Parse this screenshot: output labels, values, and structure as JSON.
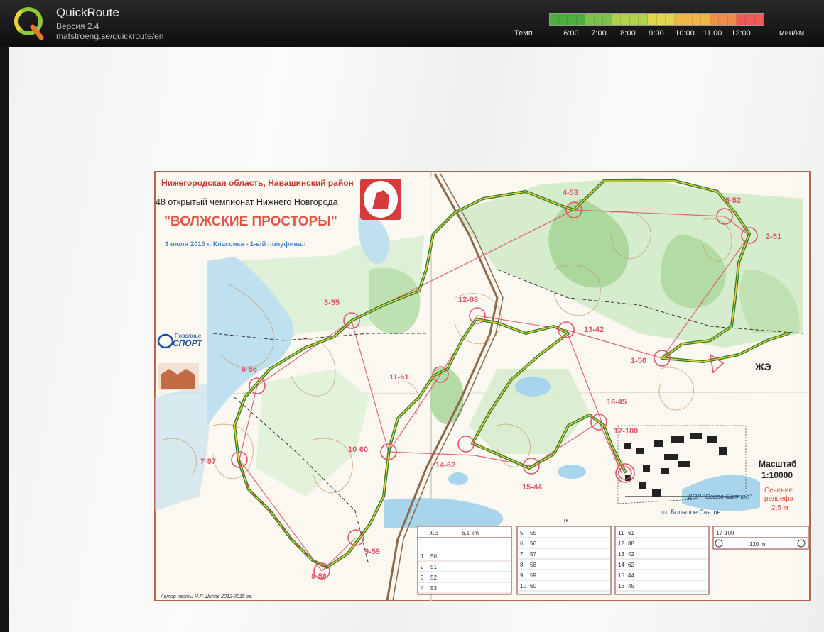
{
  "app": {
    "title": "QuickRoute",
    "version": "Версия 2.4",
    "url": "matstroeng.se/quickroute/en"
  },
  "pace_scale": {
    "label": "Темп",
    "unit": "мин/км",
    "ticks": [
      "6:00",
      "7:00",
      "8:00",
      "9:00",
      "10:00",
      "11:00",
      "12:00"
    ],
    "colors": [
      "#4cae3c",
      "#7cc24a",
      "#b3d24c",
      "#e2d64a",
      "#f0b744",
      "#ef8c4a",
      "#ef5a5a"
    ]
  },
  "map": {
    "region": "Нижегородская область, Навашинский район",
    "championship": "48 открытый чемпионат Нижнего Новгорода",
    "event_name": "\"ВОЛЖСКИЕ ПРОСТОРЫ\"",
    "date_class": "3 июля 2015 г.   Классика - 1-ый полуфинал",
    "sponsor_line1": "Поволжье",
    "sponsor_line2": "СПОРТ",
    "scale_label": "Масштаб",
    "scale_value": "1:10000",
    "contour_line1": "Сечение",
    "contour_line2": "рельефа",
    "contour_line3": "2,5 м",
    "camp_label": "ДОЛ \"Озеро Святое\"",
    "lake_label": "оз. Большое Святое",
    "class_label": "ЖЭ",
    "author": "Автор карты Н.Л.Шипов 2012-2015 гг.",
    "river_label": "тк",
    "controls": [
      "1-50",
      "2-51",
      "3-55",
      "4-53",
      "5-52",
      "6-56",
      "7-57",
      "8-58",
      "9-59",
      "10-60",
      "11-61",
      "12-88",
      "13-42",
      "14-62",
      "15-44",
      "16-45",
      "17-100"
    ],
    "legend": {
      "header_class": "ЖЭ",
      "header_length": "6,1 km",
      "col1": [
        [
          "1",
          "50"
        ],
        [
          "2",
          "51"
        ],
        [
          "3",
          "52"
        ],
        [
          "4",
          "53"
        ]
      ],
      "col2": [
        [
          "5",
          "55"
        ],
        [
          "6",
          "56"
        ],
        [
          "7",
          "57"
        ],
        [
          "8",
          "58"
        ],
        [
          "9",
          "59"
        ],
        [
          "10",
          "60"
        ]
      ],
      "col3": [
        [
          "11",
          "61"
        ],
        [
          "12",
          "88"
        ],
        [
          "13",
          "42"
        ],
        [
          "14",
          "62"
        ],
        [
          "15",
          "44"
        ],
        [
          "16",
          "45"
        ]
      ],
      "finish_num": "17",
      "finish_code": "100",
      "finish_dist": "120 m"
    }
  }
}
